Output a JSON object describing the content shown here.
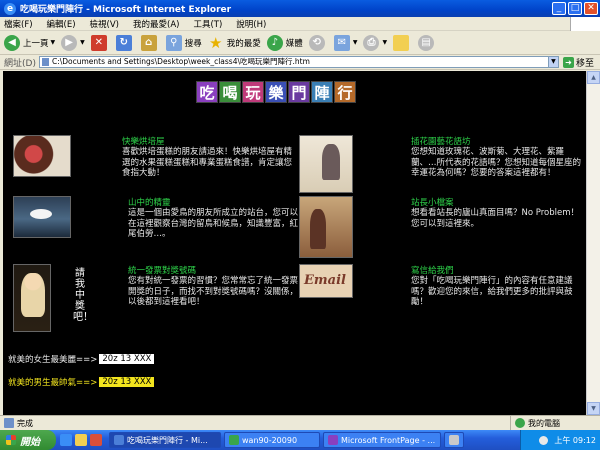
{
  "window": {
    "title": "吃喝玩樂門陣行 - Microsoft Internet Explorer"
  },
  "menu": [
    "檔案(F)",
    "編輯(E)",
    "檢視(V)",
    "我的最愛(A)",
    "工具(T)",
    "說明(H)"
  ],
  "toolbar": {
    "back": "上一頁",
    "search": "搜尋",
    "favorites": "我的最愛",
    "media": "媒體"
  },
  "address": {
    "label": "網址(D)",
    "value": "C:\\Documents and Settings\\Desktop\\week_class4\\吃喝玩樂門陣行.htm",
    "go": "移至"
  },
  "logo": {
    "chars": [
      "吃",
      "喝",
      "玩",
      "樂",
      "門",
      "陣",
      "行"
    ],
    "colors": [
      "#8a3fbf",
      "#3a8e3a",
      "#c03a7a",
      "#3a4fb5",
      "#6a3aa0",
      "#3a7fb5",
      "#b56a2a"
    ]
  },
  "sections": [
    {
      "heading": "快樂烘培屋",
      "desc": "喜歡烘培蛋糕的朋友請過來！快樂烘培屋有精選的水果蛋糕蛋糕和專業蛋糕食譜，肯定讓您食指大動！"
    },
    {
      "heading": "插花園藝花語坊",
      "desc": "您想知道玫瑰花、波斯菊、大理花、紫羅蘭、…所代表的花語嗎？您想知道每個星座的幸運花為何嗎？您要的答案這裡都有！"
    },
    {
      "heading": "山中的精靈",
      "desc": "這是一個由愛鳥的朋友所成立的站台，您可以在這裡觀察台灣的留鳥和候鳥，知識豐富，紅尾伯勞…。"
    },
    {
      "heading": "站長小檔案",
      "desc": "想看看站長的廬山真面目嗎？No Problem！您可以到這裡來。"
    },
    {
      "heading": "統一發票對獎號碼",
      "desc": "您有對統一發票的習慣？您常常忘了統一發票開獎的日子，而找不到對獎號碼嗎？沒關係，以後都到這裡看吧！"
    },
    {
      "heading": "寫信給我們",
      "desc": "您對「吃喝玩樂門陣行」的內容有任意建議嗎？歡迎您的來信，給我們更多的批評與鼓勵！"
    }
  ],
  "vertical_text": "請我中獎吧！",
  "votes": [
    {
      "label": "就美的女生最美麗==>",
      "value": "20z  13  XXX",
      "label_color": "#e8e8e8",
      "value_bg": "#ffffff"
    },
    {
      "label": "就美的男生最帥氣==>",
      "value": "20z  13  XXX",
      "label_color": "#f2e41e",
      "value_bg": "#f2e41e"
    }
  ],
  "status": {
    "left": "完成",
    "zone": "我的電腦"
  },
  "taskbar": {
    "start": "開始",
    "tasks": [
      {
        "label": "吃喝玩樂門陣行 - Mi...",
        "active": true,
        "icon_color": "#4b7fd8"
      },
      {
        "label": "wan90-20090",
        "active": false,
        "icon_color": "#3aa54a"
      },
      {
        "label": "Microsoft FrontPage - ...",
        "active": false,
        "icon_color": "#8a3fbf"
      },
      {
        "label": "",
        "active": false,
        "icon_color": "#c9c9c9"
      }
    ],
    "clock": "上午 09:12"
  }
}
